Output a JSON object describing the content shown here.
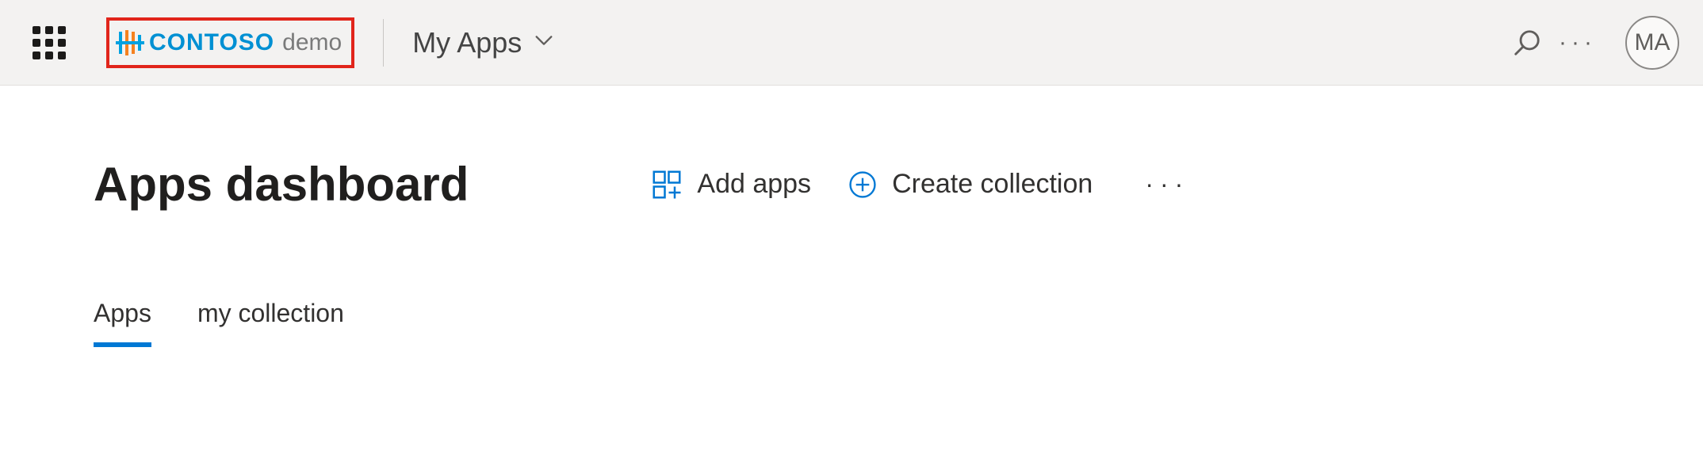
{
  "header": {
    "logo": {
      "brand": "CONTOSO",
      "suffix": "demo"
    },
    "app_switch_label": "My Apps",
    "avatar_initials": "MA"
  },
  "main": {
    "title": "Apps dashboard",
    "actions": {
      "add_apps": "Add apps",
      "create_collection": "Create collection"
    },
    "tabs": [
      {
        "label": "Apps",
        "active": true
      },
      {
        "label": "my collection",
        "active": false
      }
    ]
  }
}
